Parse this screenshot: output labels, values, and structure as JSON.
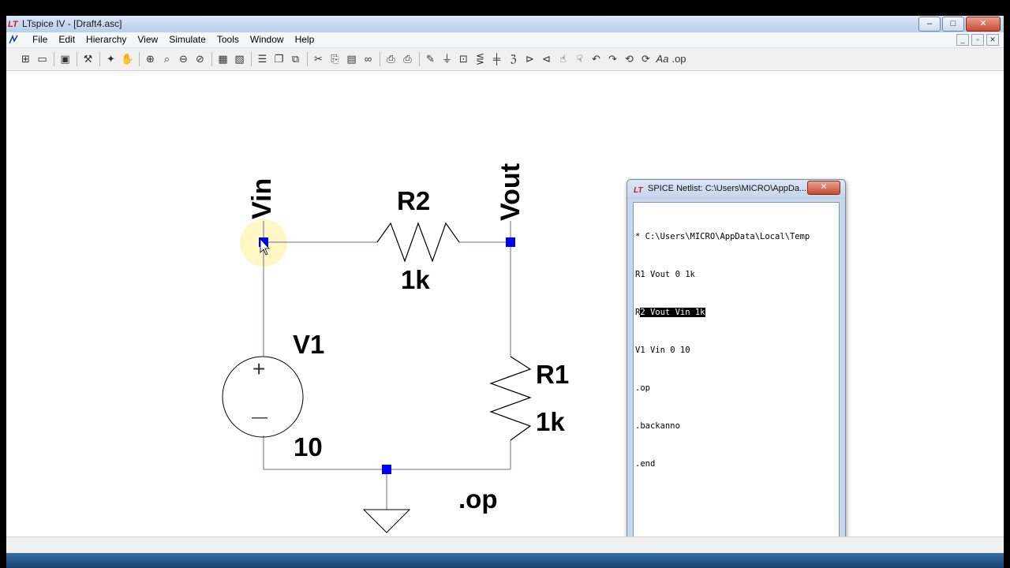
{
  "window": {
    "title": "LTspice IV - [Draft4.asc]",
    "buttons": {
      "minimize": "–",
      "maximize": "□",
      "close": "✕"
    }
  },
  "menu": {
    "items": [
      "File",
      "Edit",
      "Hierarchy",
      "View",
      "Simulate",
      "Tools",
      "Window",
      "Help"
    ]
  },
  "mdi": {
    "minimize": "_",
    "restore": "▫",
    "close": "✕"
  },
  "schematic": {
    "vin_label": "Vin",
    "vout_label": "Vout",
    "r2_name": "R2",
    "r2_value": "1k",
    "r1_name": "R1",
    "r1_value": "1k",
    "v1_name": "V1",
    "v1_value": "10",
    "directive": ".op",
    "plus_sign": "+",
    "minus_sign": "—"
  },
  "netlist": {
    "title": "SPICE Netlist: C:\\Users\\MICRO\\AppDa...",
    "close_label": "✕",
    "lines": [
      "* C:\\Users\\MICRO\\AppData\\Local\\Temp",
      "R1 Vout 0 1k",
      "R2 Vout Vin 1k",
      "V1 Vin 0 10",
      ".op",
      ".backanno",
      ".end"
    ],
    "selected_line_prefix": "R",
    "selected_line_highlight": "2 Vout Vin 1k",
    "scroll_left": "◀",
    "scroll_right": "▶",
    "scroll_grip": "|||"
  },
  "colors": {
    "wire": "#6a6aa8",
    "node": "#0000ff",
    "cursor_highlight": "#fff3a8"
  }
}
